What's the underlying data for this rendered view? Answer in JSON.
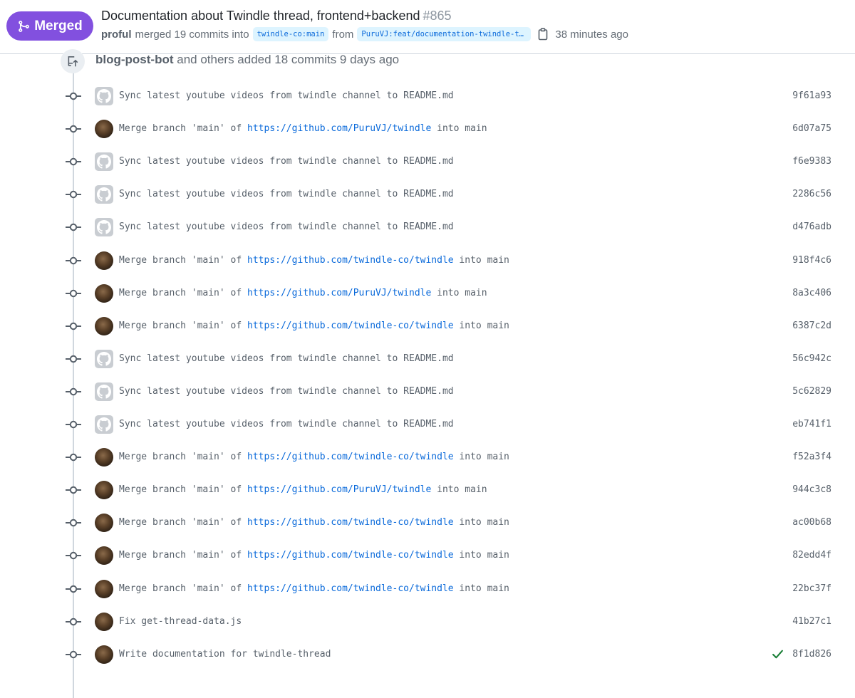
{
  "header": {
    "status_label": "Merged",
    "title": "Documentation about Twindle thread, frontend+backend",
    "number": "#865",
    "author": "proful",
    "merged_text": "merged 19 commits into",
    "base_branch": "twindle-co:main",
    "from_text": "from",
    "head_branch": "PuruVJ:feat/documentation-twindle-th…",
    "time_ago": "38 minutes ago"
  },
  "event": {
    "who": "blog-post-bot",
    "text": "and others added 18 commits 9 days ago"
  },
  "commits": [
    {
      "avatar": "bot",
      "pre": "Sync latest youtube videos from twindle channel to README.md",
      "link": "",
      "post": "",
      "sha": "9f61a93"
    },
    {
      "avatar": "person",
      "pre": "Merge branch 'main' of ",
      "link": "https://github.com/PuruVJ/twindle",
      "post": " into main",
      "sha": "6d07a75"
    },
    {
      "avatar": "bot",
      "pre": "Sync latest youtube videos from twindle channel to README.md",
      "link": "",
      "post": "",
      "sha": "f6e9383"
    },
    {
      "avatar": "bot",
      "pre": "Sync latest youtube videos from twindle channel to README.md",
      "link": "",
      "post": "",
      "sha": "2286c56"
    },
    {
      "avatar": "bot",
      "pre": "Sync latest youtube videos from twindle channel to README.md",
      "link": "",
      "post": "",
      "sha": "d476adb"
    },
    {
      "avatar": "person",
      "pre": "Merge branch 'main' of ",
      "link": "https://github.com/twindle-co/twindle",
      "post": " into main",
      "sha": "918f4c6"
    },
    {
      "avatar": "person",
      "pre": "Merge branch 'main' of ",
      "link": "https://github.com/PuruVJ/twindle",
      "post": " into main",
      "sha": "8a3c406"
    },
    {
      "avatar": "person",
      "pre": "Merge branch 'main' of ",
      "link": "https://github.com/twindle-co/twindle",
      "post": " into main",
      "sha": "6387c2d"
    },
    {
      "avatar": "bot",
      "pre": "Sync latest youtube videos from twindle channel to README.md",
      "link": "",
      "post": "",
      "sha": "56c942c"
    },
    {
      "avatar": "bot",
      "pre": "Sync latest youtube videos from twindle channel to README.md",
      "link": "",
      "post": "",
      "sha": "5c62829"
    },
    {
      "avatar": "bot",
      "pre": "Sync latest youtube videos from twindle channel to README.md",
      "link": "",
      "post": "",
      "sha": "eb741f1"
    },
    {
      "avatar": "person",
      "pre": "Merge branch 'main' of ",
      "link": "https://github.com/twindle-co/twindle",
      "post": " into main",
      "sha": "f52a3f4"
    },
    {
      "avatar": "person",
      "pre": "Merge branch 'main' of ",
      "link": "https://github.com/PuruVJ/twindle",
      "post": " into main",
      "sha": "944c3c8"
    },
    {
      "avatar": "person",
      "pre": "Merge branch 'main' of ",
      "link": "https://github.com/twindle-co/twindle",
      "post": " into main",
      "sha": "ac00b68"
    },
    {
      "avatar": "person",
      "pre": "Merge branch 'main' of ",
      "link": "https://github.com/twindle-co/twindle",
      "post": " into main",
      "sha": "82edd4f"
    },
    {
      "avatar": "person",
      "pre": "Merge branch 'main' of ",
      "link": "https://github.com/twindle-co/twindle",
      "post": " into main",
      "sha": "22bc37f"
    },
    {
      "avatar": "person",
      "pre": "Fix get-thread-data.js",
      "link": "",
      "post": "",
      "sha": "41b27c1"
    },
    {
      "avatar": "person",
      "pre": "Write documentation for twindle-thread",
      "link": "",
      "post": "",
      "sha": "8f1d826",
      "check": true
    }
  ],
  "colors": {
    "merged": "#8250df",
    "link": "#0969da",
    "success": "#1a7f37"
  }
}
